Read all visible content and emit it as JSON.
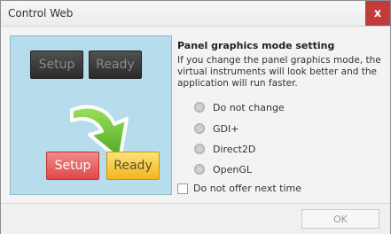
{
  "window": {
    "title": "Control Web",
    "close_label": "x"
  },
  "preview": {
    "top_buttons": [
      "Setup",
      "Ready"
    ],
    "bottom_buttons": [
      "Setup",
      "Ready"
    ]
  },
  "panel": {
    "heading": "Panel graphics mode setting",
    "description": "If you change the panel graphics mode, the virtual instruments will look better and the application will run faster.",
    "options": [
      "Do not change",
      "GDI+",
      "Direct2D",
      "OpenGL"
    ]
  },
  "checkbox": {
    "label": "Do not offer next time"
  },
  "footer": {
    "ok_label": "OK"
  },
  "colors": {
    "close": "#c23a3a",
    "preview_bg": "#b7dcec",
    "arrow": "#6cc23a"
  }
}
